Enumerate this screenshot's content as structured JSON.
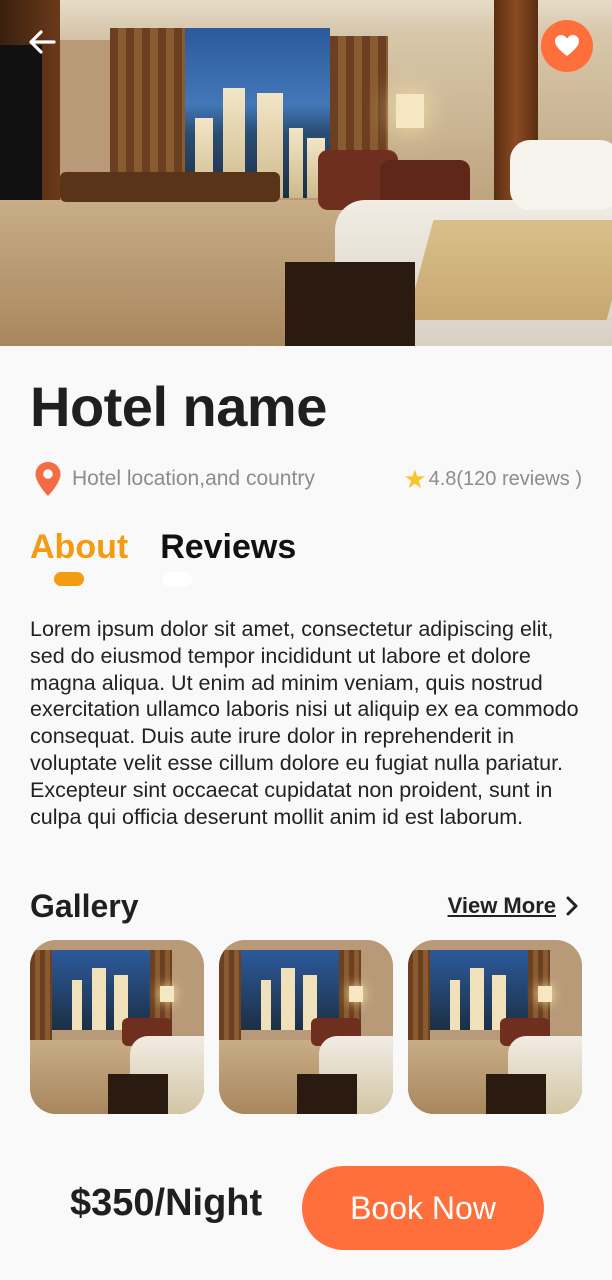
{
  "header": {
    "back_icon": "arrow-left-icon",
    "favorite_icon": "heart-icon",
    "accent_color": "#ff6f3c"
  },
  "hotel": {
    "name": "Hotel name",
    "location": "Hotel location,and country",
    "location_icon": "location-pin-icon",
    "rating": "4.8(120 reviews )",
    "rating_icon": "star-icon"
  },
  "tabs": [
    {
      "label": "About",
      "active": true
    },
    {
      "label": "Reviews",
      "active": false
    }
  ],
  "about": {
    "text": "Lorem ipsum dolor sit amet, consectetur adipiscing elit, sed do eiusmod tempor incididunt ut labore et dolore magna aliqua. Ut enim ad minim veniam, quis nostrud exercitation ullamco laboris nisi ut aliquip ex ea commodo consequat. Duis aute irure dolor in reprehenderit in voluptate velit esse cillum dolore eu fugiat nulla pariatur. Excepteur sint occaecat cupidatat non proident, sunt in culpa qui officia deserunt mollit anim id est laborum."
  },
  "gallery": {
    "title": "Gallery",
    "view_more_label": "View More",
    "view_more_icon": "chevron-right-icon"
  },
  "footer": {
    "price": "$350/Night",
    "book_label": "Book Now"
  }
}
